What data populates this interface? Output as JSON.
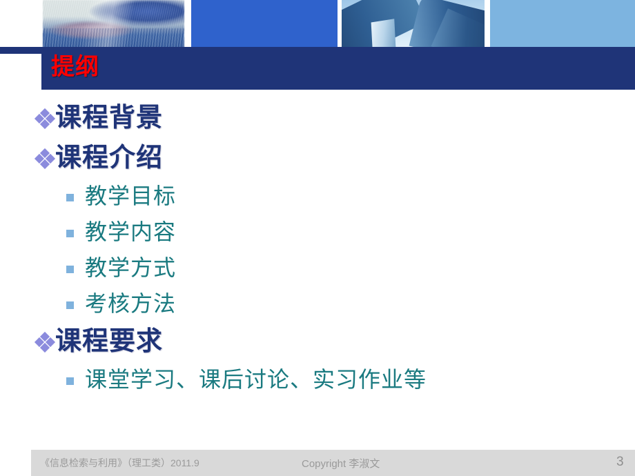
{
  "slide": {
    "title": "提纲",
    "page_number": "3",
    "title_color": "#ff0000",
    "title_bar_color": "#1f3478",
    "level1_text_color": "#1f3478",
    "level2_text_color": "#1a7a80",
    "level1_bullet_color": "#8b8bdd",
    "level2_bullet_color": "#7fb2dd"
  },
  "header": {
    "panels": [
      {
        "name": "keyboard-photo",
        "icon": "keyboard-hands-image",
        "color": "#2f5ea6"
      },
      {
        "name": "solid-blue-block",
        "icon": "solid-color-block",
        "color": "#2f62cc"
      },
      {
        "name": "skyscrapers-photo",
        "icon": "skyscraper-sun-image",
        "color": "#9ec6e8"
      },
      {
        "name": "light-blue-block",
        "icon": "solid-color-block",
        "color": "#7db4e0"
      }
    ]
  },
  "outline": [
    {
      "level": 1,
      "bullet": "diamond-cluster-bullet",
      "label": "课程背景",
      "children": []
    },
    {
      "level": 1,
      "bullet": "diamond-cluster-bullet",
      "label": "课程介绍",
      "children": [
        {
          "level": 2,
          "bullet": "small-square-bullet",
          "label": "教学目标"
        },
        {
          "level": 2,
          "bullet": "small-square-bullet",
          "label": "教学内容"
        },
        {
          "level": 2,
          "bullet": "small-square-bullet",
          "label": "教学方式"
        },
        {
          "level": 2,
          "bullet": "small-square-bullet",
          "label": "考核方法"
        }
      ]
    },
    {
      "level": 1,
      "bullet": "diamond-cluster-bullet",
      "label": "课程要求",
      "children": [
        {
          "level": 2,
          "bullet": "small-square-bullet",
          "label": "课堂学习、课后讨论、实习作业等"
        }
      ]
    }
  ],
  "footer": {
    "source": "《信息检索与利用》（理工类）2011.9",
    "copyright": "Copyright  李淑文",
    "page_number": "3"
  }
}
